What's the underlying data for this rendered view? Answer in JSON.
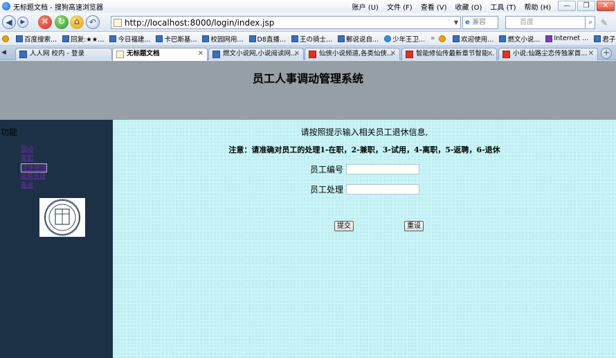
{
  "window": {
    "title": "无标题文档 - 搜狗高速浏览器",
    "menu": [
      "账户 (U)",
      "文件 (F)",
      "查看 (V)",
      "收藏 (O)",
      "工具 (T)",
      "帮助 (H)"
    ],
    "buttons": [
      "—",
      "❐",
      "✕"
    ]
  },
  "toolbar": {
    "url": "http://localhost:8000/login/index.jsp",
    "compat_label": "兼容",
    "search_placeholder": "百度"
  },
  "favorites": [
    {
      "label": "百度搜索...",
      "icon": "page-icon"
    },
    {
      "label": "回复:★★...",
      "icon": "page-icon"
    },
    {
      "label": "今日福建...",
      "icon": "page-icon"
    },
    {
      "label": "卡巴斯基...",
      "icon": "page-icon"
    },
    {
      "label": "校园网用...",
      "icon": "page-icon"
    },
    {
      "label": "D8直播...",
      "icon": "page-icon"
    },
    {
      "label": "王の骑士...",
      "icon": "page-icon"
    },
    {
      "label": "郵说说自...",
      "icon": "page-icon"
    },
    {
      "label": "少年王卫...",
      "icon": "play-icon"
    }
  ],
  "favorites_right": [
    {
      "label": "欢迎使用...",
      "icon": "page-icon"
    },
    {
      "label": "燃文小说...",
      "icon": "page-icon"
    },
    {
      "label": "Internet ...",
      "icon": "page-icon"
    },
    {
      "label": "君子堂 - ...",
      "icon": "page-icon"
    }
  ],
  "tabs": [
    {
      "label": "人人网 校内 - 登录",
      "active": false
    },
    {
      "label": "无标题文档",
      "active": true
    },
    {
      "label": "燃文小说网,小说阅读网...",
      "active": false
    },
    {
      "label": "仙侠小说频道,各类仙侠...",
      "active": false
    },
    {
      "label": "智能修仙传最新章节智能...",
      "active": false
    },
    {
      "label": "小说:仙路尘恋传独家首...",
      "active": false
    }
  ],
  "page": {
    "header_title": "员工人事调动管理系统",
    "sidebar": {
      "label": "功能",
      "items": [
        "调动",
        "离职",
        "退休管理",
        "返聘管理",
        "查询"
      ],
      "selected_index": 2
    },
    "form": {
      "prompt": "请按照提示输入相关员工退休信息,",
      "notice": "注意：请准确对员工的处理1-在职，2-兼职，3-试用，4-离职，5-返聘，6-退休",
      "employee_id_label": "员工编号",
      "employee_id_value": "",
      "handling_label": "员工处理",
      "handling_value": "",
      "submit_label": "提交",
      "reset_label": "重设"
    }
  },
  "colors": {
    "header_bg": "#969ea6",
    "sidebar_bg": "#1d3146",
    "main_bg": "#c7f3f6",
    "link": "#6e2aa8"
  }
}
